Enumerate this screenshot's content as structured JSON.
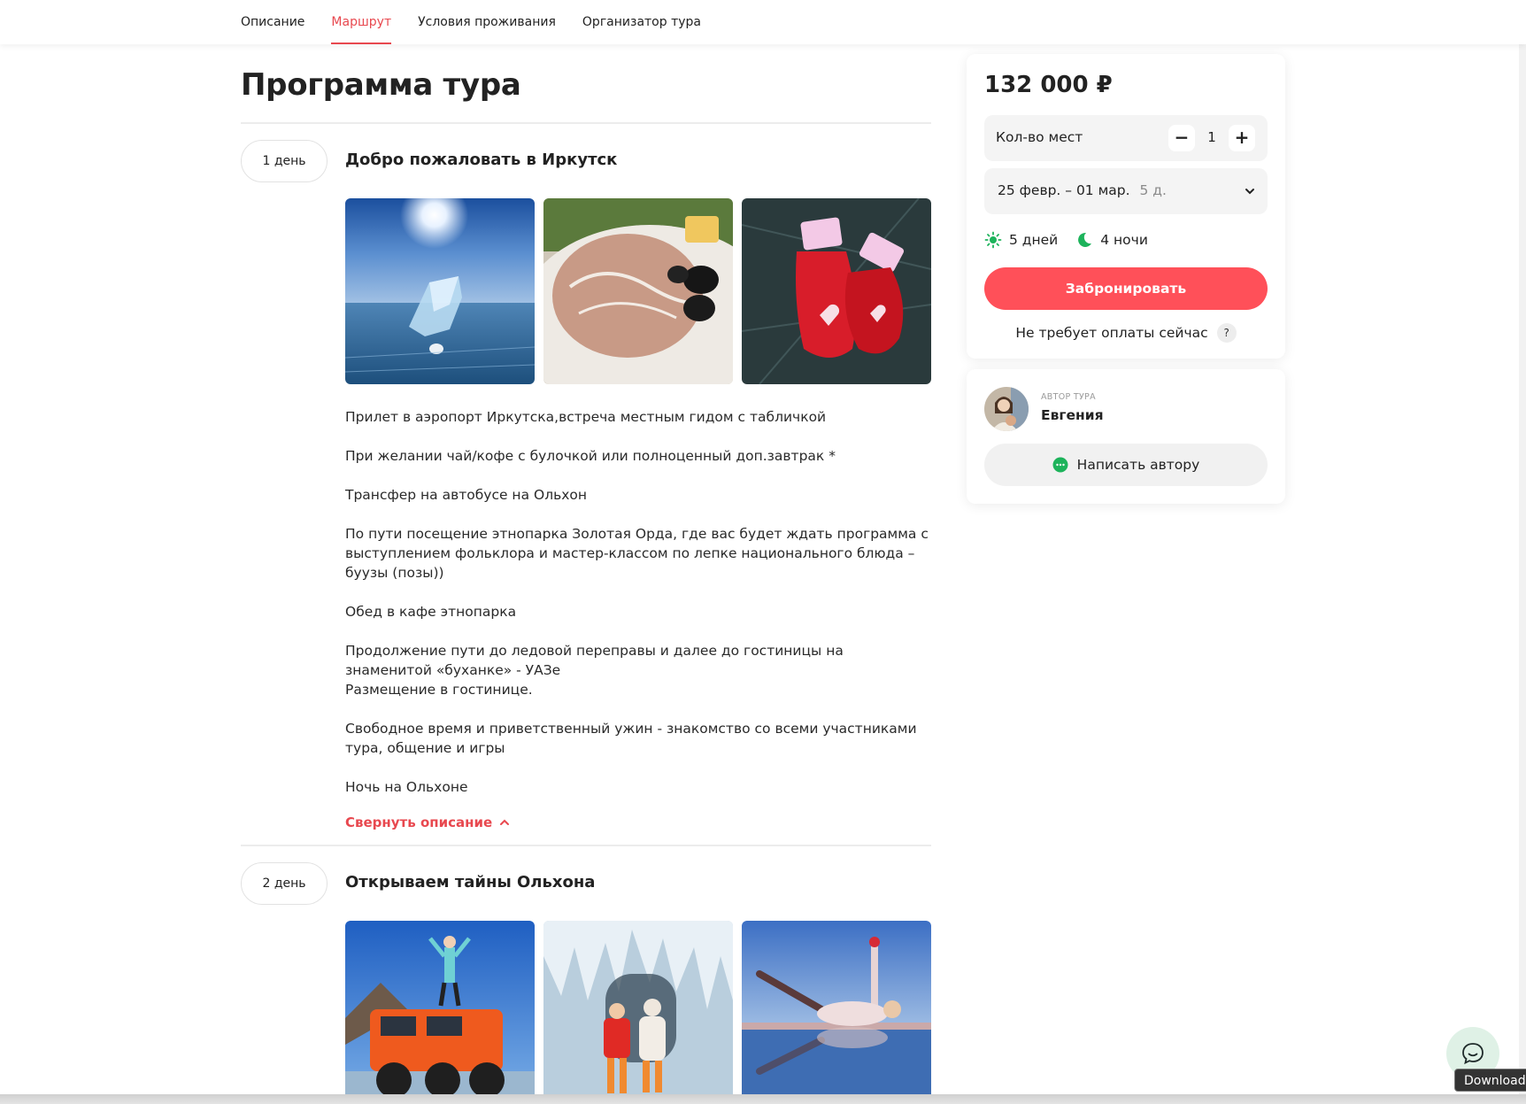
{
  "nav": {
    "tabs": [
      {
        "label": "Описание",
        "active": false
      },
      {
        "label": "Маршрут",
        "active": true
      },
      {
        "label": "Условия проживания",
        "active": false
      },
      {
        "label": "Организатор тура",
        "active": false
      }
    ]
  },
  "main": {
    "title": "Программа тура",
    "days": [
      {
        "badge": "1 день",
        "title": "Добро пожаловать в Иркутск",
        "photos": [
          "ice-on-baikal-photo",
          "herring-salad-photo",
          "red-mittens-photo"
        ],
        "paragraphs": [
          "Прилет в аэропорт Иркутска,встреча местным гидом с табличкой",
          "При желании чай/кофе с булочкой или полноценный доп.завтрак *",
          "Трансфер на автобусе на Ольхон",
          "По пути посещение этнопарка Золотая Орда, где вас будет ждать программа с выступлением фольклора и мастер-классом по лепке национального блюда – буузы (позы))",
          "Обед в кафе этнопарка",
          "Продолжение пути до ледовой переправы и далее до гостиницы на знаменитой «буханке» - УАЗе\nРазмещение в гостинице.",
          "Свободное время и приветственный ужин - знакомство со всеми участниками тура, общение и игры",
          "Ночь на Ольхоне"
        ],
        "collapse_label": "Свернуть описание"
      },
      {
        "badge": "2 день",
        "title": "Открываем тайны Ольхона",
        "photos": [
          "orange-offroad-truck-photo",
          "ice-cave-couple-photo",
          "ice-reflection-pose-photo"
        ]
      }
    ]
  },
  "booking": {
    "price": "132 000 ₽",
    "seats_label": "Кол-во мест",
    "seats_count": "1",
    "minus": "−",
    "plus": "+",
    "date_range": "25 февр. – 01 мар.",
    "duration": "5 д.",
    "days_text": "5 дней",
    "nights_text": "4 ночи",
    "book_label": "Забронировать",
    "no_payment": "Не требует оплаты сейчас",
    "help_mark": "?",
    "colors": {
      "accent": "#ff5059",
      "link": "#e8484f",
      "green": "#1db35b"
    }
  },
  "author": {
    "caption": "АВТОР ТУРА",
    "name": "Евгения",
    "write_label": "Написать автору"
  },
  "overlay": {
    "downloads_label": "Downloads"
  }
}
